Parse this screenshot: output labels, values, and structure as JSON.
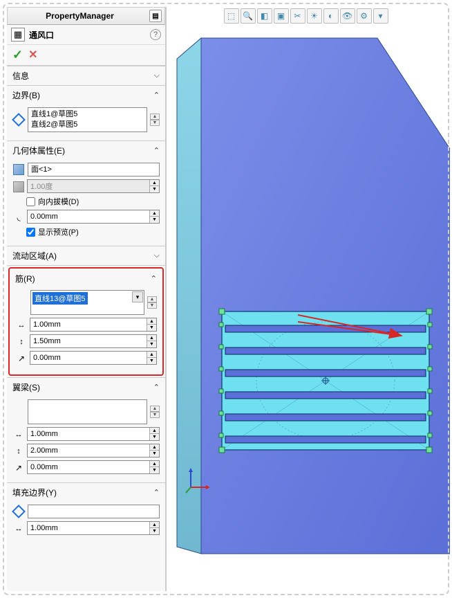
{
  "header": {
    "title": "PropertyManager"
  },
  "feature": {
    "name": "通风口",
    "help_tooltip": "?"
  },
  "sections": {
    "info": {
      "label": "信息"
    },
    "boundary": {
      "label": "边界(B)",
      "items": [
        "直线1@草图5",
        "直线2@草图5"
      ]
    },
    "geometry": {
      "label": "几何体属性(E)",
      "face": "面<1>",
      "draft_angle": "1.00度",
      "draft_inward_label": "向内拔模(D)",
      "draft_inward_checked": false,
      "offset": "0.00mm",
      "show_preview_label": "显示预览(P)",
      "show_preview_checked": true
    },
    "flow": {
      "label": "流动区域(A)"
    },
    "ribs": {
      "label": "筋(R)",
      "selected_item": "直线13@草图5",
      "d1": "1.00mm",
      "d2": "1.50mm",
      "angle": "0.00mm"
    },
    "spars": {
      "label": "翼梁(S)",
      "d1": "1.00mm",
      "d2": "2.00mm",
      "angle": "0.00mm"
    },
    "fillin": {
      "label": "填充边界(Y)",
      "d1": "1.00mm"
    }
  }
}
